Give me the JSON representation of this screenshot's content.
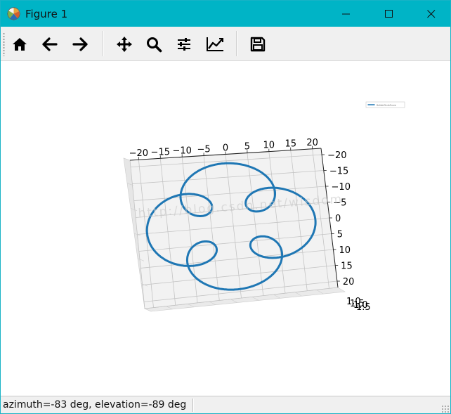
{
  "window": {
    "title": "Figure 1",
    "buttons": {
      "minimize": "minimize",
      "maximize": "maximize",
      "close": "close"
    }
  },
  "toolbar": {
    "buttons": [
      {
        "name": "home-button",
        "icon": "home-icon"
      },
      {
        "name": "back-button",
        "icon": "arrow-left-icon"
      },
      {
        "name": "forward-button",
        "icon": "arrow-right-icon"
      },
      {
        "name": "pan-button",
        "icon": "move-icon"
      },
      {
        "name": "zoom-button",
        "icon": "magnifier-icon"
      },
      {
        "name": "configure-subplots-button",
        "icon": "sliders-icon"
      },
      {
        "name": "edit-axes-button",
        "icon": "line-chart-icon"
      },
      {
        "name": "save-button",
        "icon": "floppy-disk-icon"
      }
    ]
  },
  "status": {
    "text": "azimuth=-83 deg, elevation=-89 deg"
  },
  "chart_data": {
    "type": "line",
    "projection": "3d",
    "view": {
      "azimuth": -83,
      "elevation": -89
    },
    "series": [
      {
        "name": "HelixInCircleCurve",
        "color": "#1f77b4"
      }
    ],
    "legend": {
      "label": "HelixInCircleCurve",
      "placement": "top-right"
    },
    "x_ticks": [
      "−20",
      "−15",
      "−10",
      "−5",
      "0",
      "5",
      "10",
      "15",
      "20"
    ],
    "y_ticks": [
      "−20",
      "−15",
      "−10",
      "−5",
      "0",
      "5",
      "10",
      "15",
      "20"
    ],
    "z_tick_labels": [
      "1.0",
      "1.5"
    ],
    "xlim": [
      -22,
      22
    ],
    "ylim": [
      -22,
      22
    ],
    "grid": true,
    "curve": {
      "outer_radius": 14,
      "inner_radius": 7,
      "lobes": 5
    },
    "watermark": "http://blog.csdn.net/wisdom"
  }
}
